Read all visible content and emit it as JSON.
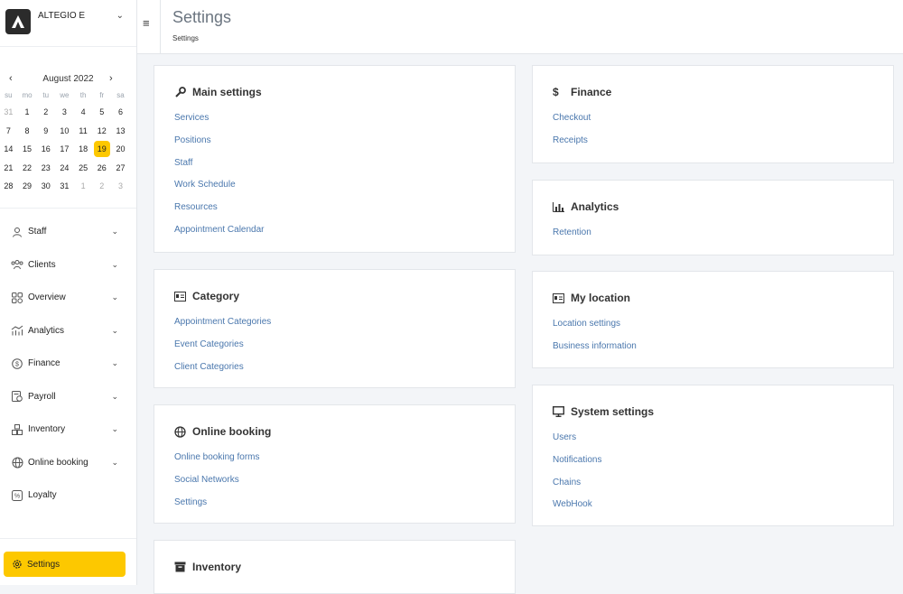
{
  "brand": {
    "name": "ALTEGIO E"
  },
  "calendar": {
    "month_label": "August 2022",
    "weekdays": [
      "su",
      "mo",
      "tu",
      "we",
      "th",
      "fr",
      "sa"
    ],
    "weeks": [
      [
        {
          "d": "31",
          "m": false
        },
        {
          "d": "1"
        },
        {
          "d": "2"
        },
        {
          "d": "3"
        },
        {
          "d": "4"
        },
        {
          "d": "5"
        },
        {
          "d": "6"
        }
      ],
      [
        {
          "d": "7"
        },
        {
          "d": "8"
        },
        {
          "d": "9"
        },
        {
          "d": "10"
        },
        {
          "d": "11"
        },
        {
          "d": "12"
        },
        {
          "d": "13"
        }
      ],
      [
        {
          "d": "14"
        },
        {
          "d": "15"
        },
        {
          "d": "16"
        },
        {
          "d": "17"
        },
        {
          "d": "18"
        },
        {
          "d": "19",
          "today": true
        },
        {
          "d": "20"
        }
      ],
      [
        {
          "d": "21"
        },
        {
          "d": "22"
        },
        {
          "d": "23"
        },
        {
          "d": "24"
        },
        {
          "d": "25"
        },
        {
          "d": "26"
        },
        {
          "d": "27"
        }
      ],
      [
        {
          "d": "28"
        },
        {
          "d": "29"
        },
        {
          "d": "30"
        },
        {
          "d": "31"
        },
        {
          "d": "1",
          "m": false
        },
        {
          "d": "2",
          "m": false
        },
        {
          "d": "3",
          "m": false
        }
      ]
    ]
  },
  "sidebar": {
    "items": [
      {
        "label": "Staff",
        "icon": "user-icon"
      },
      {
        "label": "Clients",
        "icon": "clients-icon"
      },
      {
        "label": "Overview",
        "icon": "overview-icon"
      },
      {
        "label": "Analytics",
        "icon": "analytics-icon"
      },
      {
        "label": "Finance",
        "icon": "dollar-icon"
      },
      {
        "label": "Payroll",
        "icon": "payroll-icon"
      },
      {
        "label": "Inventory",
        "icon": "inventory-icon"
      },
      {
        "label": "Online booking",
        "icon": "globe-icon"
      },
      {
        "label": "Loyalty",
        "icon": "loyalty-icon"
      }
    ],
    "settings_label": "Settings"
  },
  "header": {
    "title": "Settings",
    "breadcrumb": "Settings"
  },
  "cards": {
    "main_settings": {
      "title": "Main settings",
      "links": [
        "Services",
        "Positions",
        "Staff",
        "Work Schedule",
        "Resources",
        "Appointment Calendar"
      ]
    },
    "category": {
      "title": "Category",
      "links": [
        "Appointment Categories",
        "Event Categories",
        "Client Categories"
      ]
    },
    "online_booking": {
      "title": "Online booking",
      "links": [
        "Online booking forms",
        "Social Networks",
        "Settings"
      ]
    },
    "inventory": {
      "title": "Inventory",
      "links": []
    },
    "finance": {
      "title": "Finance",
      "links": [
        "Checkout",
        "Receipts"
      ]
    },
    "analytics": {
      "title": "Analytics",
      "links": [
        "Retention"
      ]
    },
    "my_location": {
      "title": "My location",
      "links": [
        "Location settings",
        "Business information"
      ]
    },
    "system_settings": {
      "title": "System settings",
      "links": [
        "Users",
        "Notifications",
        "Chains",
        "WebHook"
      ]
    }
  },
  "colors": {
    "accent": "#fdc800",
    "link": "#4a77ad",
    "title_gray": "#6b7580"
  }
}
